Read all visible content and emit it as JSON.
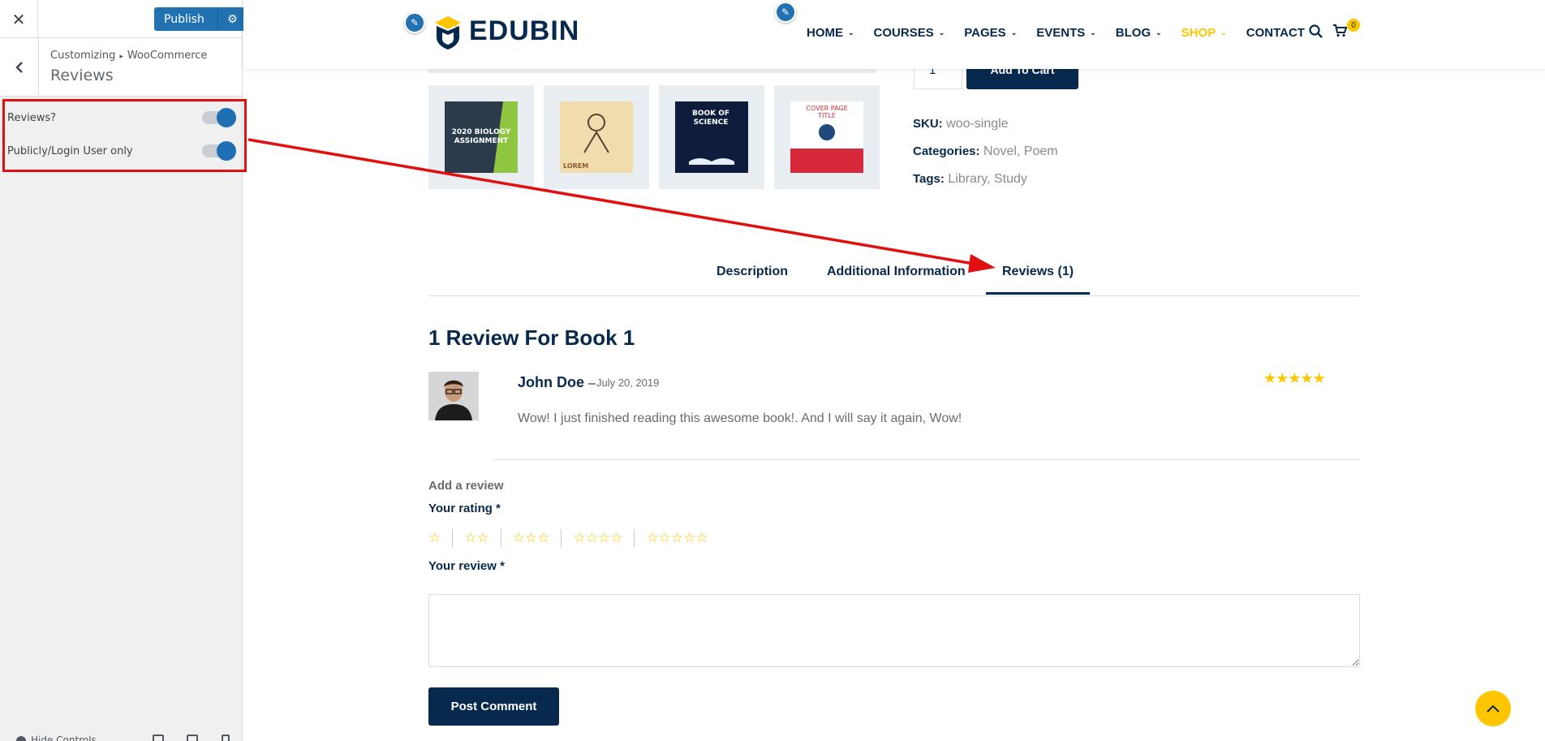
{
  "customizer": {
    "close_icon": "✕",
    "publish_label": "Publish",
    "settings_icon": "⚙",
    "back_icon": "‹",
    "breadcrumb_root": "Customizing",
    "breadcrumb_sep": "▸",
    "breadcrumb_section": "WooCommerce",
    "section_title": "Reviews",
    "controls": [
      {
        "label": "Reviews?",
        "enabled": true
      },
      {
        "label": "Publicly/Login User only",
        "enabled": true
      }
    ],
    "footer_label": "Hide Controls"
  },
  "header": {
    "logo_text": "EDUBIN",
    "nav": [
      {
        "label": "HOME",
        "dropdown": true
      },
      {
        "label": "COURSES",
        "dropdown": true
      },
      {
        "label": "PAGES",
        "dropdown": true
      },
      {
        "label": "EVENTS",
        "dropdown": true
      },
      {
        "label": "BLOG",
        "dropdown": true
      },
      {
        "label": "SHOP",
        "dropdown": true,
        "active": true
      },
      {
        "label": "CONTACT",
        "dropdown": false
      }
    ],
    "cart_count": "0",
    "accent_color": "#ffc600",
    "brand_color": "#07294d"
  },
  "product": {
    "qty_value": "1",
    "add_to_cart_label": "Add To Cart",
    "sku_label": "SKU:",
    "sku_value": "woo-single",
    "categories_label": "Categories:",
    "categories": [
      "Novel",
      "Poem"
    ],
    "tags_label": "Tags:",
    "tags": [
      "Library",
      "Study"
    ],
    "thumbnails": [
      {
        "text": "2020 BIOLOGY ASSIGNMENT"
      },
      {
        "text": "LOREM"
      },
      {
        "text": "BOOK OF SCIENCE"
      },
      {
        "text": "COVER PAGE TITLE"
      }
    ]
  },
  "tabs": {
    "items": [
      "Description",
      "Additional Information",
      "Reviews (1)"
    ],
    "active": "Reviews (1)"
  },
  "reviews": {
    "heading": "1 Review For Book 1",
    "items": [
      {
        "author": "John Doe",
        "dash": "–",
        "date": "July 20, 2019",
        "rating": 5,
        "stars": "★★★★★",
        "text": "Wow! I just finished reading this awesome book!. And I will say it again, Wow!"
      }
    ],
    "form": {
      "add_review_label": "Add a review",
      "rating_label": "Your rating *",
      "rating_options": [
        "☆",
        "☆☆",
        "☆☆☆",
        "☆☆☆☆",
        "☆☆☆☆☆"
      ],
      "review_label": "Your review *",
      "review_value": "",
      "submit_label": "Post Comment"
    }
  }
}
